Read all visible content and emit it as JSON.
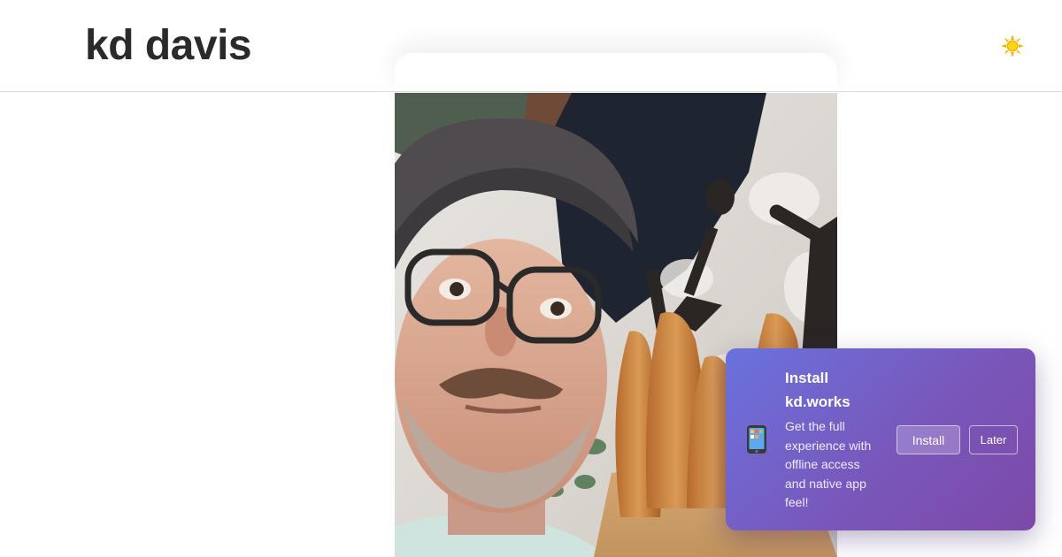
{
  "header": {
    "site_title": "kd davis",
    "theme_toggle_icon": "sun-icon"
  },
  "hero": {
    "image_subject": "selfie of man in flat cap and glasses holding baguettes"
  },
  "install_prompt": {
    "icon": "mobile-phone-icon",
    "title": "Install kd.works",
    "description": "Get the full experience with offline access and native app feel!",
    "install_label": "Install",
    "later_label": "Later",
    "gradient_start": "#6a72dd",
    "gradient_end": "#7c4aa8"
  },
  "colors": {
    "title_text": "#2a2a2a",
    "sun": "#f5b800",
    "header_border": "#dedede"
  }
}
